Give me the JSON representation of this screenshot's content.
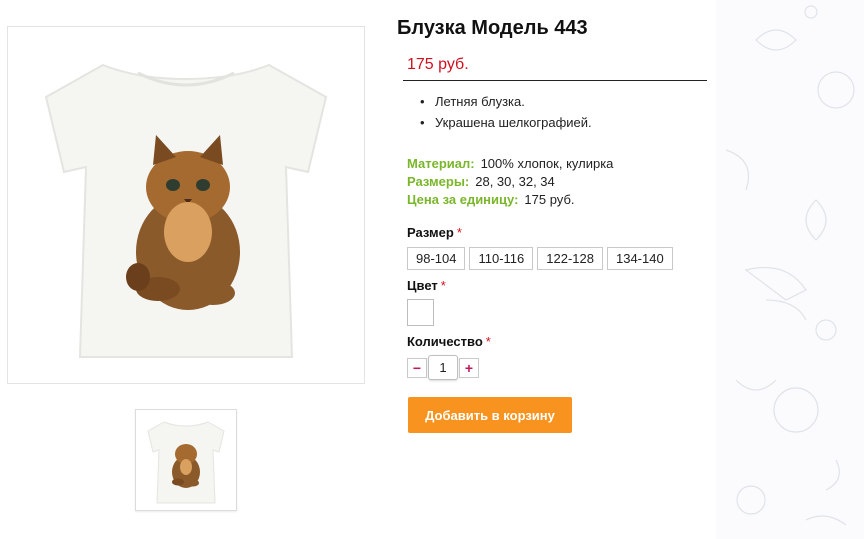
{
  "product": {
    "title": "Блузка Модель 443",
    "price": "175 руб.",
    "features": [
      "Летняя блузка.",
      "Украшена шелкографией."
    ],
    "specs": [
      {
        "label": "Материал:",
        "value": "100% хлопок, кулирка"
      },
      {
        "label": "Размеры:",
        "value": "28, 30, 32, 34"
      },
      {
        "label": "Цена за единицу:",
        "value": "175 руб."
      }
    ]
  },
  "options": {
    "size_label": "Размер",
    "sizes": [
      "98-104",
      "110-116",
      "122-128",
      "134-140"
    ],
    "color_label": "Цвет",
    "quantity_label": "Количество",
    "required_mark": "*",
    "quantity_value": "1",
    "minus": "−",
    "plus": "+"
  },
  "actions": {
    "add_to_cart": "Добавить в корзину"
  },
  "colors": {
    "price": "#d0101e",
    "spec_label": "#7ab62a",
    "button": "#f7931e"
  },
  "icons": {
    "main_image": "tshirt-kitten-image",
    "thumbnail": "tshirt-kitten-thumbnail"
  }
}
